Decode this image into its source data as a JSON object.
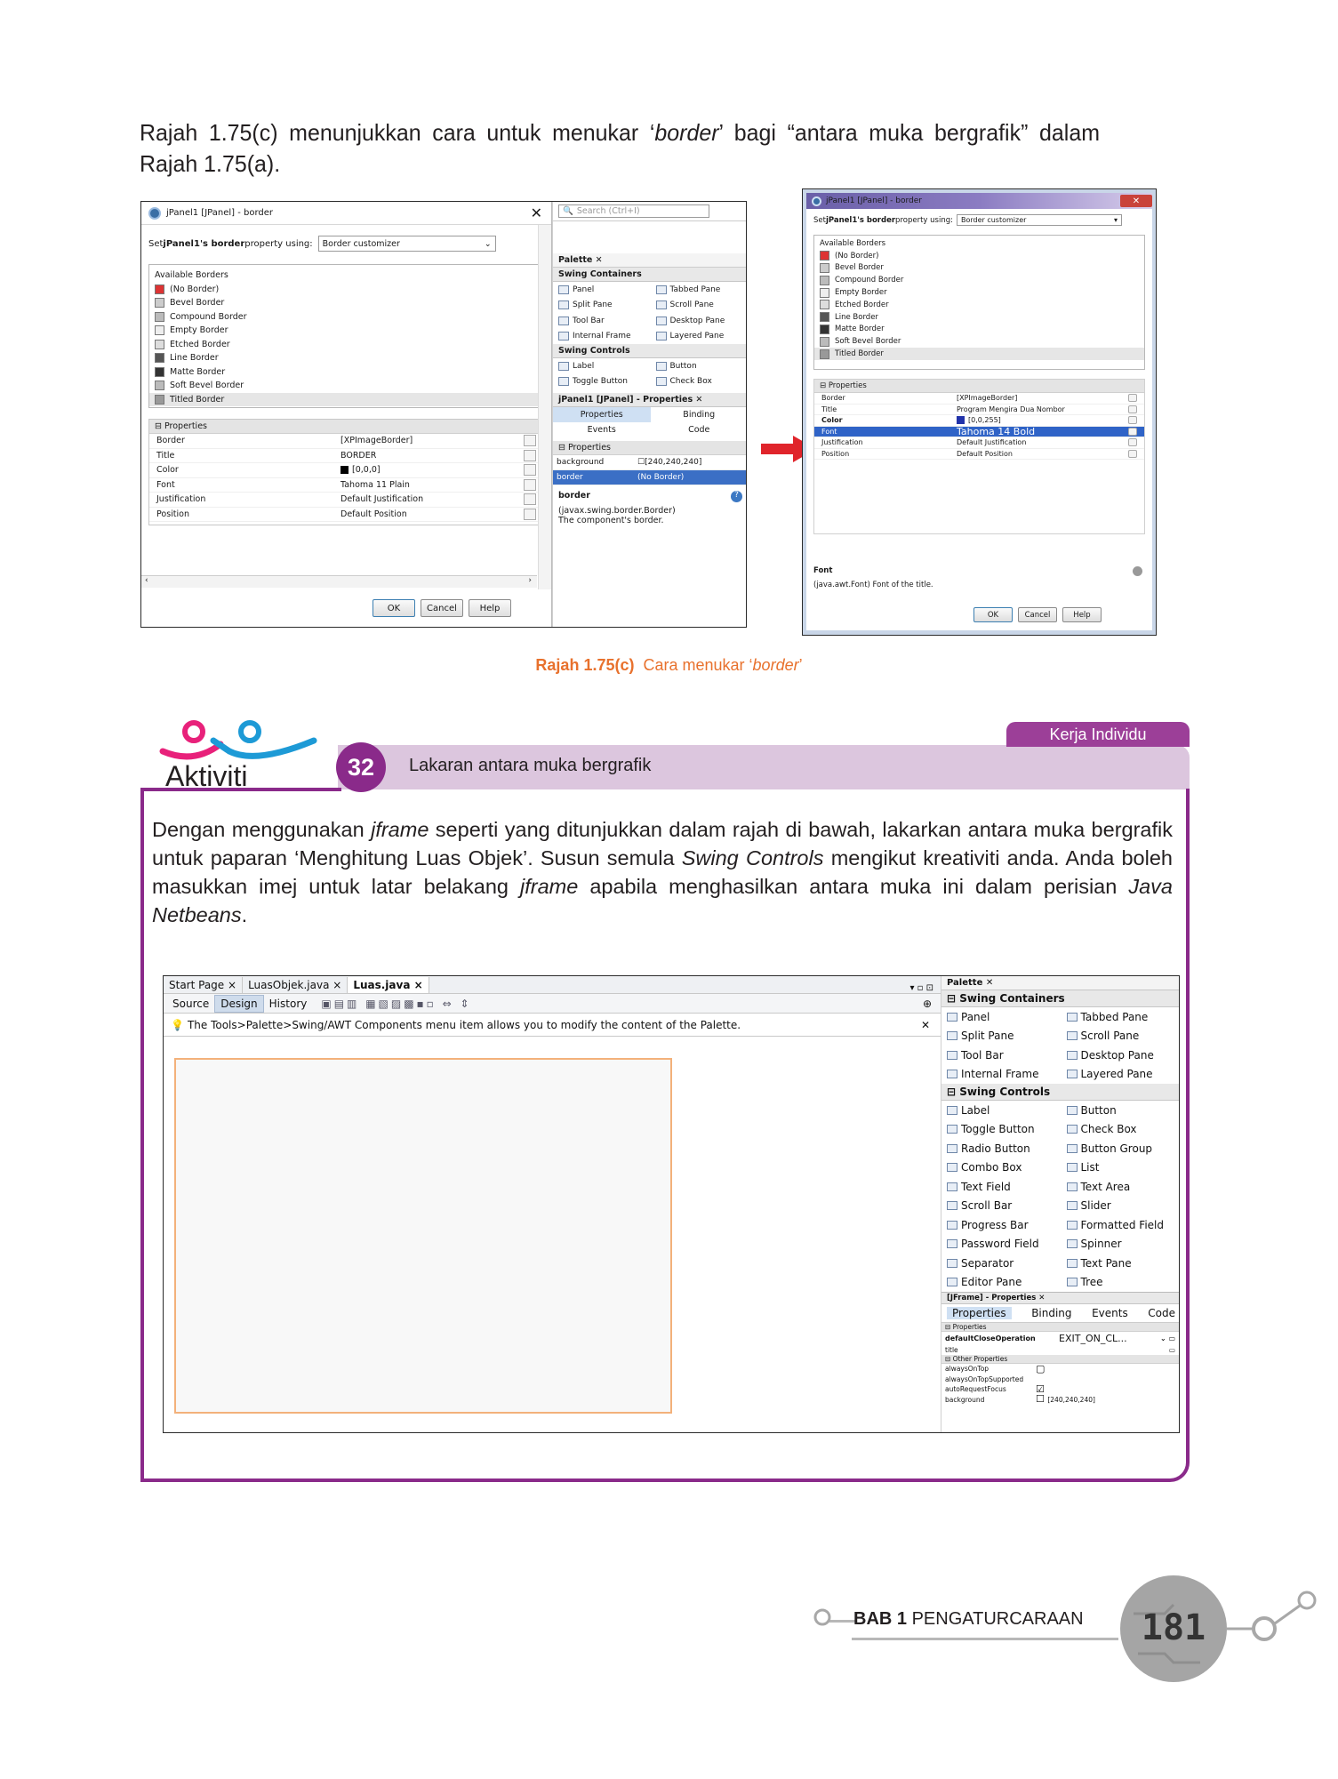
{
  "intro": {
    "text_part1": "Rajah 1.75(c) menunjukkan cara untuk menukar ‘",
    "text_italic": "border",
    "text_part2": "’ bagi “antara muka bergrafik” dalam Rajah 1.75(a)."
  },
  "left_shot": {
    "title": "jPanel1 [JPanel] - border",
    "set_label_pre": "Set ",
    "set_label_bold": "jPanel1's border",
    "set_label_post": " property using:",
    "customizer": "Border customizer",
    "search_placeholder": "Search (Ctrl+I)",
    "available_borders": "Available Borders",
    "borders": [
      "(No Border)",
      "Bevel Border",
      "Compound Border",
      "Empty Border",
      "Etched Border",
      "Line Border",
      "Matte Border",
      "Soft Bevel Border",
      "Titled Border"
    ],
    "properties_header": "Properties",
    "props": [
      {
        "k": "Border",
        "v": "[XPImageBorder]"
      },
      {
        "k": "Title",
        "v": "BORDER"
      },
      {
        "k": "Color",
        "v": "[0,0,0]"
      },
      {
        "k": "Font",
        "v": "Tahoma 11 Plain"
      },
      {
        "k": "Justification",
        "v": "Default Justification"
      },
      {
        "k": "Position",
        "v": "Default Position"
      }
    ],
    "ok": "OK",
    "cancel": "Cancel",
    "help": "Help",
    "palette_tab": "Palette",
    "swing_containers": "Swing Containers",
    "containers": [
      "Panel",
      "Tabbed Pane",
      "Split Pane",
      "Scroll Pane",
      "Tool Bar",
      "Desktop Pane",
      "Internal Frame",
      "Layered Pane"
    ],
    "swing_controls": "Swing Controls",
    "controls": [
      "Label",
      "Button",
      "Toggle Button",
      "Check Box"
    ],
    "props_tab": "jPanel1 [JPanel] - Properties",
    "tabs": [
      "Properties",
      "Binding",
      "Events",
      "Code"
    ],
    "prop_section": "Properties",
    "bg_k": "background",
    "bg_v": "[240,240,240]",
    "border_k": "border",
    "border_v": "(No Border)",
    "help_title": "border",
    "help_text": "(javax.swing.border.Border) The component's border."
  },
  "right_shot": {
    "title": "jPanel1 [JPanel] - border",
    "set_label_pre": "Set ",
    "set_label_bold": "jPanel1's border",
    "set_label_post": " property using:",
    "customizer": "Border customizer",
    "available_borders": "Available Borders",
    "borders": [
      "(No Border)",
      "Bevel Border",
      "Compound Border",
      "Empty Border",
      "Etched Border",
      "Line Border",
      "Matte Border",
      "Soft Bevel Border",
      "Titled Border"
    ],
    "properties_header": "Properties",
    "props": [
      {
        "k": "Border",
        "v": "[XPImageBorder]"
      },
      {
        "k": "Title",
        "v": "Program Mengira Dua Nombor"
      },
      {
        "k": "Color",
        "v": "[0,0,255]"
      },
      {
        "k": "Font",
        "v": "Tahoma 14 Bold"
      },
      {
        "k": "Justification",
        "v": "Default Justification"
      },
      {
        "k": "Position",
        "v": "Default Position"
      }
    ],
    "help_title": "Font",
    "help_text": "(java.awt.Font) Font of the title.",
    "ok": "OK",
    "cancel": "Cancel",
    "help": "Help"
  },
  "caption": {
    "label": "Rajah 1.75(c)",
    "text_pre": "Cara menukar ‘",
    "text_italic": "border",
    "text_post": "’"
  },
  "activity": {
    "logo": "Aktiviti",
    "badge": "Kerja Individu",
    "number": "32",
    "title": "Lakaran antara muka bergrafik",
    "p1": "Dengan menggunakan ",
    "i1": "jframe",
    "p2": " seperti yang ditunjukkan dalam rajah di bawah, lakarkan antara muka bergrafik untuk paparan ‘Menghitung Luas Objek’. Susun semula ",
    "i2": "Swing Controls",
    "p3": " mengikut kreativiti anda. Anda boleh masukkan imej untuk latar belakang ",
    "i3": "jframe",
    "p4": " apabila menghasilkan antara muka ini dalam perisian ",
    "i4": "Java Netbeans",
    "p5": "."
  },
  "netbeans": {
    "tabs": [
      "Start Page",
      "LuasObjek.java",
      "Luas.java"
    ],
    "modes": [
      "Source",
      "Design",
      "History"
    ],
    "tip": "The Tools>Palette>Swing/AWT Components menu item allows you to modify the content of the Palette.",
    "palette_tab": "Palette",
    "swing_containers": "Swing Containers",
    "containers": [
      "Panel",
      "Tabbed Pane",
      "Split Pane",
      "Scroll Pane",
      "Tool Bar",
      "Desktop Pane",
      "Internal Frame",
      "Layered Pane"
    ],
    "swing_controls": "Swing Controls",
    "controls": [
      "Label",
      "Button",
      "Toggle Button",
      "Check Box",
      "Radio Button",
      "Button Group",
      "Combo Box",
      "List",
      "Text Field",
      "Text Area",
      "Scroll Bar",
      "Slider",
      "Progress Bar",
      "Formatted Field",
      "Password Field",
      "Spinner",
      "Separator",
      "Text Pane",
      "Editor Pane",
      "Tree"
    ],
    "props_tab": "[JFrame] - Properties",
    "ptabs": [
      "Properties",
      "Binding",
      "Events",
      "Code"
    ],
    "sec1": "Properties",
    "dco_k": "defaultCloseOperation",
    "dco_v": "EXIT_ON_CL...",
    "title_k": "title",
    "sec2": "Other Properties",
    "other": [
      "alwaysOnTop",
      "alwaysOnTopSupported",
      "autoRequestFocus",
      "background"
    ],
    "bg_v": "[240,240,240]"
  },
  "footer": {
    "bab": "BAB 1",
    "chapter": "PENGATURCARAAN",
    "page": "181"
  }
}
